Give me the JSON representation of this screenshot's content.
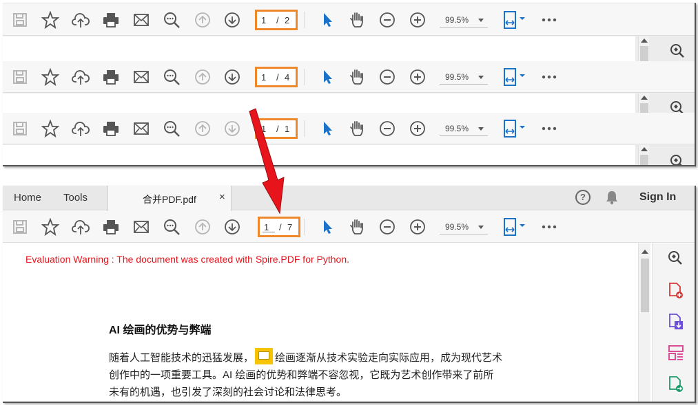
{
  "toolbar_rows": [
    {
      "page_current": "1",
      "page_total": "2",
      "zoom": "99.5%"
    },
    {
      "page_current": "1",
      "page_total": "4",
      "zoom": "99.5%"
    },
    {
      "page_current": "1",
      "page_total": "1",
      "zoom": "99.5%"
    }
  ],
  "page_sep": "/",
  "window": {
    "nav_tabs": [
      "Home",
      "Tools"
    ],
    "document_tab": "合并PDF.pdf",
    "close_symbol": "×",
    "help_symbol": "?",
    "sign_in": "Sign In",
    "toolbar": {
      "page_current": "1",
      "page_total": "7",
      "zoom": "99.5%"
    }
  },
  "document": {
    "warning": "Evaluation Warning : The document was created with Spire.PDF for Python.",
    "heading": "AI 绘画的优势与弊端",
    "para_line1_before_icon": "随着人工智能技术的迅猛发展，",
    "para_line1_after_icon": "绘画逐渐从技术实验走向实际应用，成为现代艺术",
    "para_line2": "创作中的一项重要工具。AI 绘画的优势和弊端不容忽视，它既为艺术创作带来了前所",
    "para_line3": "未有的机遇，也引发了深刻的社会讨论和法律思考。"
  },
  "colors": {
    "highlight_box": "#f0882a",
    "warning_text": "#e5141b",
    "arrow": "#e8141b",
    "accent_blue": "#1a73c9"
  },
  "icons": [
    "save-icon",
    "bookmark-star-icon",
    "upload-cloud-icon",
    "print-icon",
    "mail-icon",
    "search-zoom-icon",
    "page-up-icon",
    "page-down-icon",
    "select-cursor-icon",
    "hand-icon",
    "zoom-out-icon",
    "zoom-in-icon",
    "fit-page-icon",
    "more-icon"
  ]
}
